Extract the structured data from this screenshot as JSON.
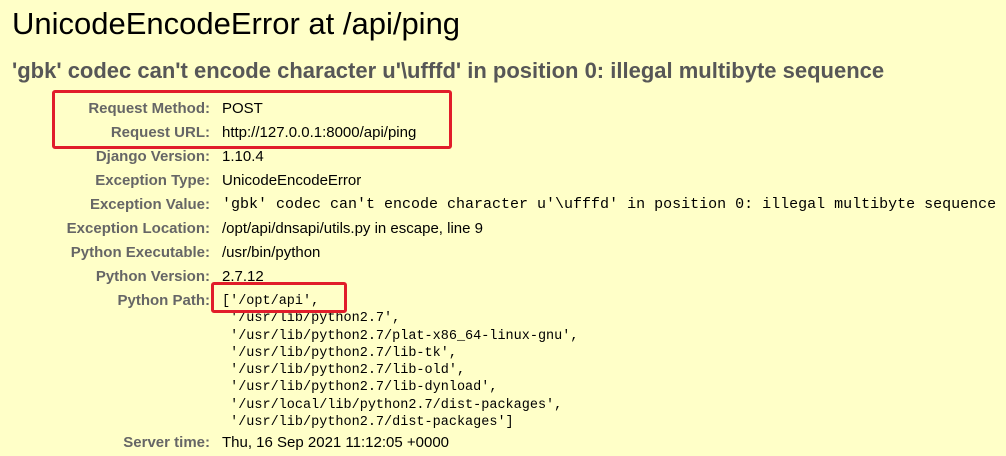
{
  "page": {
    "title": "UnicodeEncodeError at /api/ping",
    "subtitle": "'gbk' codec can't encode character u'\\ufffd' in position 0: illegal multibyte sequence"
  },
  "meta": {
    "request_method_label": "Request Method:",
    "request_method": "POST",
    "request_url_label": "Request URL:",
    "request_url": "http://127.0.0.1:8000/api/ping",
    "django_version_label": "Django Version:",
    "django_version": "1.10.4",
    "exception_type_label": "Exception Type:",
    "exception_type": "UnicodeEncodeError",
    "exception_value_label": "Exception Value:",
    "exception_value": "'gbk' codec can't encode character u'\\ufffd' in position 0: illegal multibyte sequence",
    "exception_location_label": "Exception Location:",
    "exception_location": "/opt/api/dnsapi/utils.py in escape, line 9",
    "python_executable_label": "Python Executable:",
    "python_executable": "/usr/bin/python",
    "python_version_label": "Python Version:",
    "python_version": "2.7.12",
    "python_path_label": "Python Path:",
    "python_path": [
      "['/opt/api',",
      " '/usr/lib/python2.7',",
      " '/usr/lib/python2.7/plat-x86_64-linux-gnu',",
      " '/usr/lib/python2.7/lib-tk',",
      " '/usr/lib/python2.7/lib-old',",
      " '/usr/lib/python2.7/lib-dynload',",
      " '/usr/local/lib/python2.7/dist-packages',",
      " '/usr/lib/python2.7/dist-packages']"
    ],
    "server_time_label": "Server time:",
    "server_time": "Thu, 16 Sep 2021 11:12:05 +0000"
  },
  "colors": {
    "background": "#ffffc8",
    "label_gray": "#666666",
    "subtitle_gray": "#575757",
    "highlight_red": "#e11d2a"
  }
}
